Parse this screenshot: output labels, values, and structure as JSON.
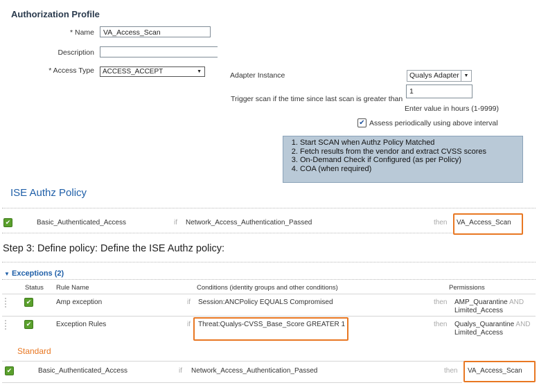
{
  "profile": {
    "title": "Authorization Profile",
    "name_label": "* Name",
    "name_value": "VA_Access_Scan",
    "description_label": "Description",
    "description_value": "",
    "access_type_label": "* Access Type",
    "access_type_value": "ACCESS_ACCEPT",
    "adapter_label": "Adapter Instance",
    "adapter_value": "Qualys Adapter",
    "trigger_label": "Trigger scan if the time since last scan is greater than",
    "trigger_value": "1",
    "trigger_hint": "Enter value in hours (1-9999)",
    "assess_label": "Assess periodically using above interval",
    "assess_checked": true
  },
  "note": {
    "items": [
      "Start SCAN when Authz Policy Matched",
      "Fetch results from the vendor and extract CVSS scores",
      "On-Demand Check if Configured (as per Policy)",
      "COA (when required)"
    ]
  },
  "authz": {
    "title": "ISE Authz Policy",
    "rule_name": "Basic_Authenticated_Access",
    "if_word": "if",
    "condition": "Network_Access_Authentication_Passed",
    "then_word": "then",
    "result": "VA_Access_Scan"
  },
  "step_text": "Step 3: Define policy: Define the ISE Authz policy:",
  "exceptions": {
    "title": "Exceptions (2)",
    "columns": [
      "Status",
      "Rule Name",
      "Conditions (identity groups and other conditions)",
      "Permissions"
    ],
    "rows": [
      {
        "name": "Amp exception",
        "if_word": "if",
        "condition": "Session:ANCPolicy EQUALS Compromised",
        "then_word": "then",
        "perm1": "AMP_Quarantine",
        "and_word": "AND",
        "perm2": "Limited_Access"
      },
      {
        "name": "Exception Rules",
        "if_word": "if",
        "condition": "Threat:Qualys-CVSS_Base_Score GREATER 1",
        "then_word": "then",
        "perm1": "Qualys_Quarantine",
        "and_word": "AND",
        "perm2": "Limited_Access"
      }
    ]
  },
  "standard": {
    "title": "Standard",
    "rule_name": "Basic_Authenticated_Access",
    "if_word": "if",
    "condition": "Network_Access_Authentication_Passed",
    "then_word": "then",
    "result": "VA_Access_Scan"
  },
  "colors": {
    "highlight": "#e87722",
    "check_green": "#5aa02c",
    "link_blue": "#1f5fa8",
    "note_bg": "#b9c9d7"
  }
}
